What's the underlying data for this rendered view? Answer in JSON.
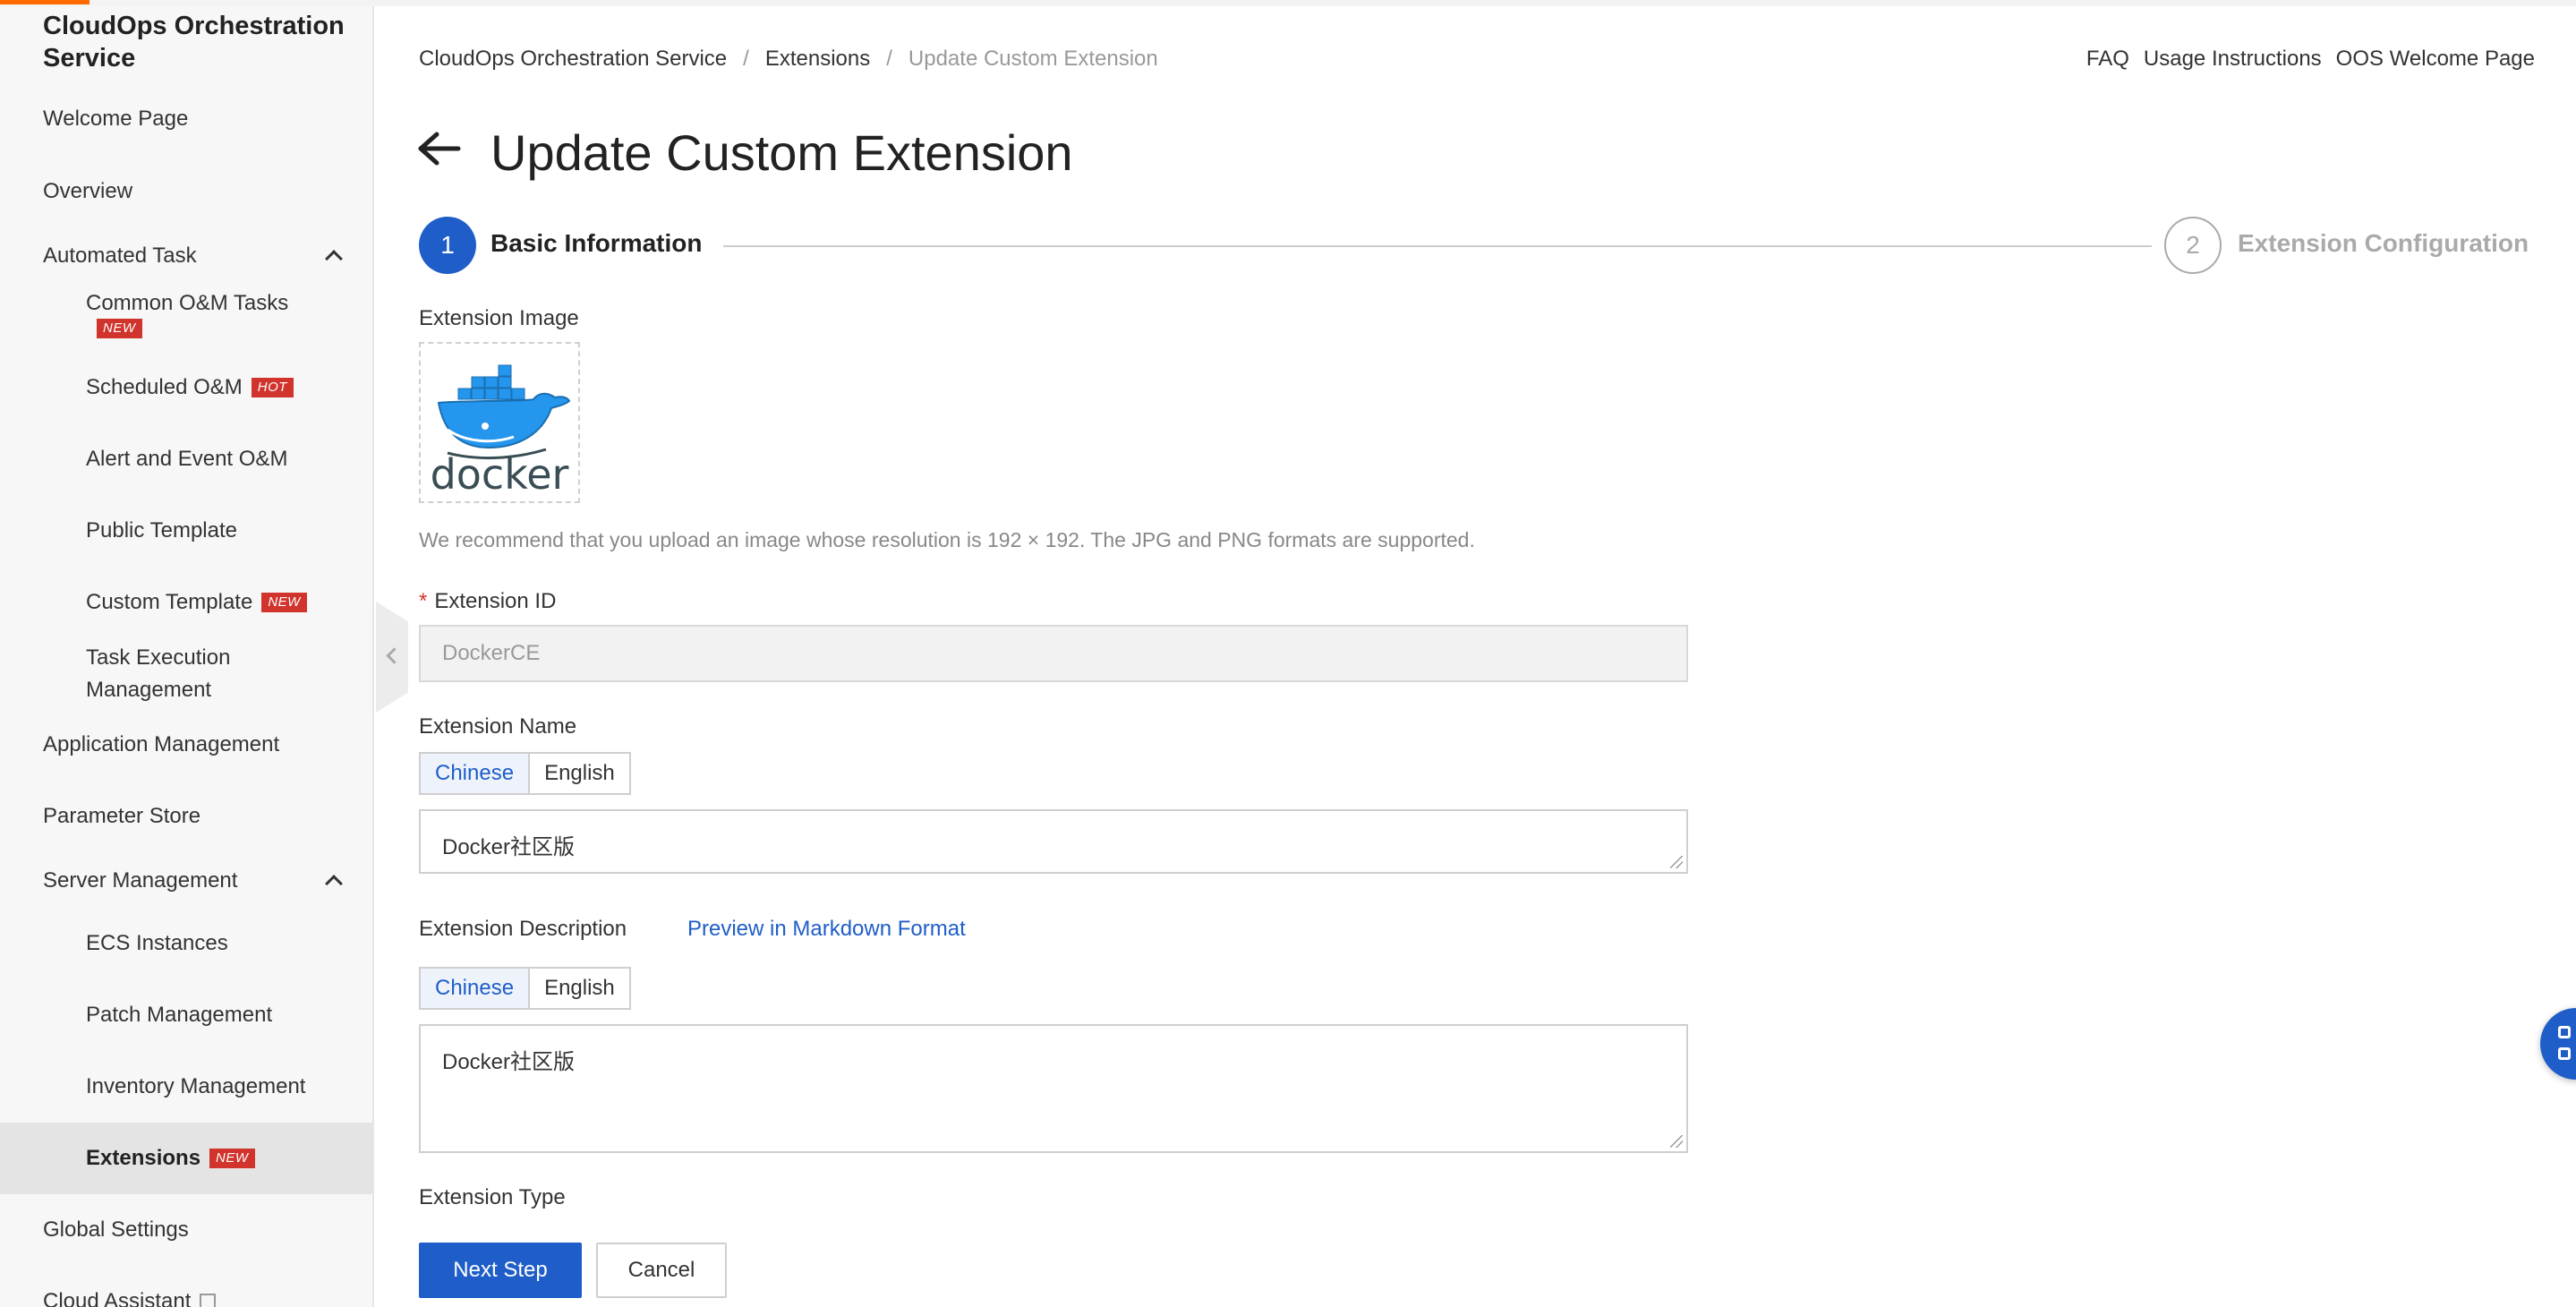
{
  "sidebar": {
    "brand": "CloudOps Orchestration Service",
    "items": {
      "welcome": "Welcome Page",
      "overview": "Overview",
      "automated_task": "Automated Task",
      "common_om": "Common O&M Tasks",
      "scheduled_om": "Scheduled O&M",
      "alert_event_om": "Alert and Event O&M",
      "public_template": "Public Template",
      "custom_template": "Custom Template",
      "task_execution_1": "Task Execution",
      "task_execution_2": "Management",
      "application_management": "Application Management",
      "parameter_store": "Parameter Store",
      "server_management": "Server Management",
      "ecs_instances": "ECS Instances",
      "patch_management": "Patch Management",
      "inventory_management": "Inventory Management",
      "extensions": "Extensions",
      "global_settings": "Global Settings",
      "cloud_assistant": "Cloud Assistant"
    },
    "badges": {
      "new": "NEW",
      "hot": "HOT"
    }
  },
  "breadcrumb": {
    "root": "CloudOps Orchestration Service",
    "parent": "Extensions",
    "current": "Update Custom Extension",
    "separator": "/"
  },
  "top_links": {
    "faq": "FAQ",
    "usage": "Usage Instructions",
    "welcome": "OOS Welcome Page"
  },
  "page": {
    "title": "Update Custom Extension"
  },
  "steps": [
    {
      "number": "1",
      "label": "Basic Information",
      "active": true
    },
    {
      "number": "2",
      "label": "Extension Configuration",
      "active": false
    }
  ],
  "form": {
    "image_label": "Extension Image",
    "image_logo_text": "docker",
    "image_hint": "We recommend that you upload an image whose resolution is 192 × 192. The JPG and PNG formats are supported.",
    "id_required_mark": "*",
    "id_label": "Extension ID",
    "id_value": "DockerCE",
    "name_label": "Extension Name",
    "lang_chinese": "Chinese",
    "lang_english": "English",
    "name_value": "Docker社区版",
    "description_label": "Extension Description",
    "markdown_preview": "Preview in Markdown Format",
    "description_value": "Docker社区版",
    "type_label": "Extension Type"
  },
  "actions": {
    "next": "Next Step",
    "cancel": "Cancel"
  },
  "colors": {
    "primary": "#1f5ec8",
    "accent": "#ff6a00",
    "badge": "#d0342c",
    "docker_blue": "#2496ed",
    "docker_text": "#394d54"
  }
}
